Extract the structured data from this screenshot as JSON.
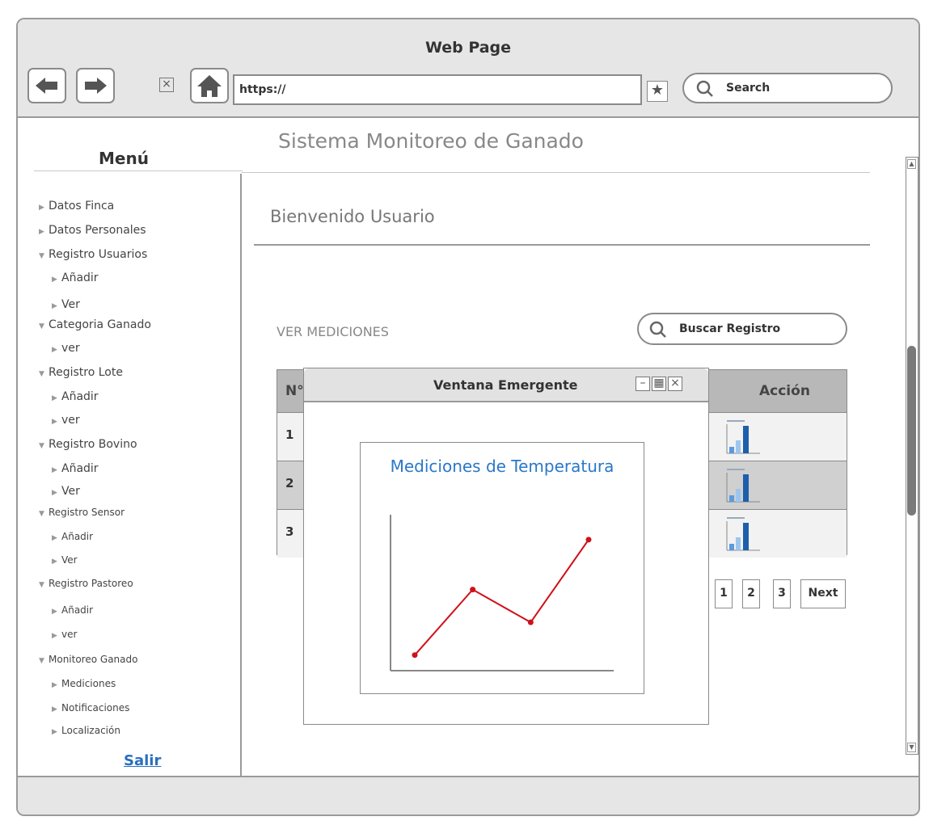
{
  "browser": {
    "window_title": "Web Page",
    "url": "https://",
    "search_placeholder": "Search"
  },
  "sidebar": {
    "title": "Menú",
    "items": [
      {
        "label": "Datos Finca",
        "level": 0,
        "expanded": false
      },
      {
        "label": "Datos Personales",
        "level": 0,
        "expanded": false
      },
      {
        "label": "Registro Usuarios",
        "level": 0,
        "expanded": true
      },
      {
        "label": "Añadir",
        "level": 1,
        "expanded": false
      },
      {
        "label": "Ver",
        "level": 1,
        "expanded": false
      },
      {
        "label": "Categoria Ganado",
        "level": 0,
        "expanded": true
      },
      {
        "label": "ver",
        "level": 1,
        "expanded": false
      },
      {
        "label": "Registro Lote",
        "level": 0,
        "expanded": true
      },
      {
        "label": "Añadir",
        "level": 1,
        "expanded": false
      },
      {
        "label": "ver",
        "level": 1,
        "expanded": false
      },
      {
        "label": "Registro Bovino",
        "level": 0,
        "expanded": true
      },
      {
        "label": "Añadir",
        "level": 1,
        "expanded": false
      },
      {
        "label": "Ver",
        "level": 1,
        "expanded": false
      },
      {
        "label": "Registro Sensor",
        "level": 0,
        "expanded": true
      },
      {
        "label": "Añadir",
        "level": 1,
        "expanded": false
      },
      {
        "label": "Ver",
        "level": 1,
        "expanded": false
      },
      {
        "label": "Registro Pastoreo",
        "level": 0,
        "expanded": true
      },
      {
        "label": "Añadir",
        "level": 1,
        "expanded": false
      },
      {
        "label": "ver",
        "level": 1,
        "expanded": false
      },
      {
        "label": "Monitoreo Ganado",
        "level": 0,
        "expanded": true
      },
      {
        "label": "Mediciones",
        "level": 1,
        "expanded": false
      },
      {
        "label": "Notificaciones",
        "level": 1,
        "expanded": false
      },
      {
        "label": "Localización",
        "level": 1,
        "expanded": false
      }
    ],
    "logout": "Salir"
  },
  "main": {
    "app_title": "Sistema Monitoreo de Ganado",
    "welcome": "Bienvenido Usuario",
    "section_title": "VER MEDICIONES",
    "search_placeholder": "Buscar Registro",
    "table": {
      "col_no": "N°",
      "col_action": "Acción",
      "rows": [
        "1",
        "2",
        "3"
      ]
    },
    "pagination": [
      "1",
      "2",
      "3",
      "Next"
    ]
  },
  "popup": {
    "title": "Ventana Emergente",
    "chart_title": "Mediciones de Temperatura"
  },
  "chart_data": {
    "type": "line",
    "title": "Mediciones de Temperatura",
    "x": [
      1,
      2,
      3,
      4
    ],
    "values": [
      1.0,
      5.2,
      3.1,
      8.4
    ],
    "ylim": [
      0,
      10
    ],
    "xlabel": "",
    "ylabel": "",
    "grid": false,
    "color": "#d0101a"
  }
}
